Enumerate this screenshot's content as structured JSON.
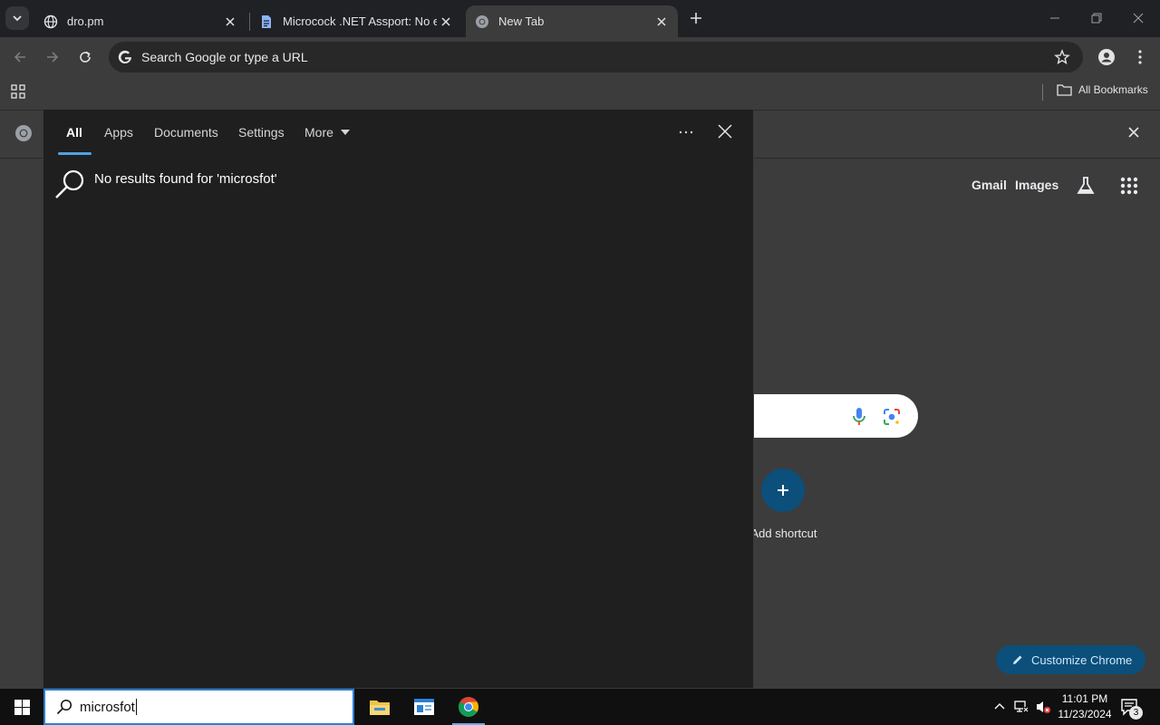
{
  "browser": {
    "tabs": [
      {
        "title": "dro.pm",
        "favicon": "globe-icon",
        "active": false
      },
      {
        "title": "Microcock .NET Assport: No ea",
        "favicon": "document-icon",
        "active": false
      },
      {
        "title": "New Tab",
        "favicon": "chrome-icon",
        "active": true
      }
    ],
    "omnibox": {
      "placeholder": "Search Google or type a URL"
    },
    "bookmarks": {
      "all_label": "All Bookmarks"
    }
  },
  "ntp": {
    "links": {
      "gmail": "Gmail",
      "images": "Images"
    },
    "shortcut_label": "Add shortcut",
    "customize_label": "Customize Chrome",
    "accent": "#0b4f7a"
  },
  "search_flyout": {
    "tabs": [
      "All",
      "Apps",
      "Documents",
      "Settings",
      "More"
    ],
    "active_tab": "All",
    "message": "No results found for 'microsfot'",
    "accent": "#4fa3e6"
  },
  "taskbar": {
    "search_query": "microsfot",
    "apps": [
      "file-explorer-icon",
      "app-window-icon",
      "chrome-icon"
    ],
    "clock": {
      "time": "11:01 PM",
      "date": "11/23/2024"
    },
    "notifications": "3"
  }
}
